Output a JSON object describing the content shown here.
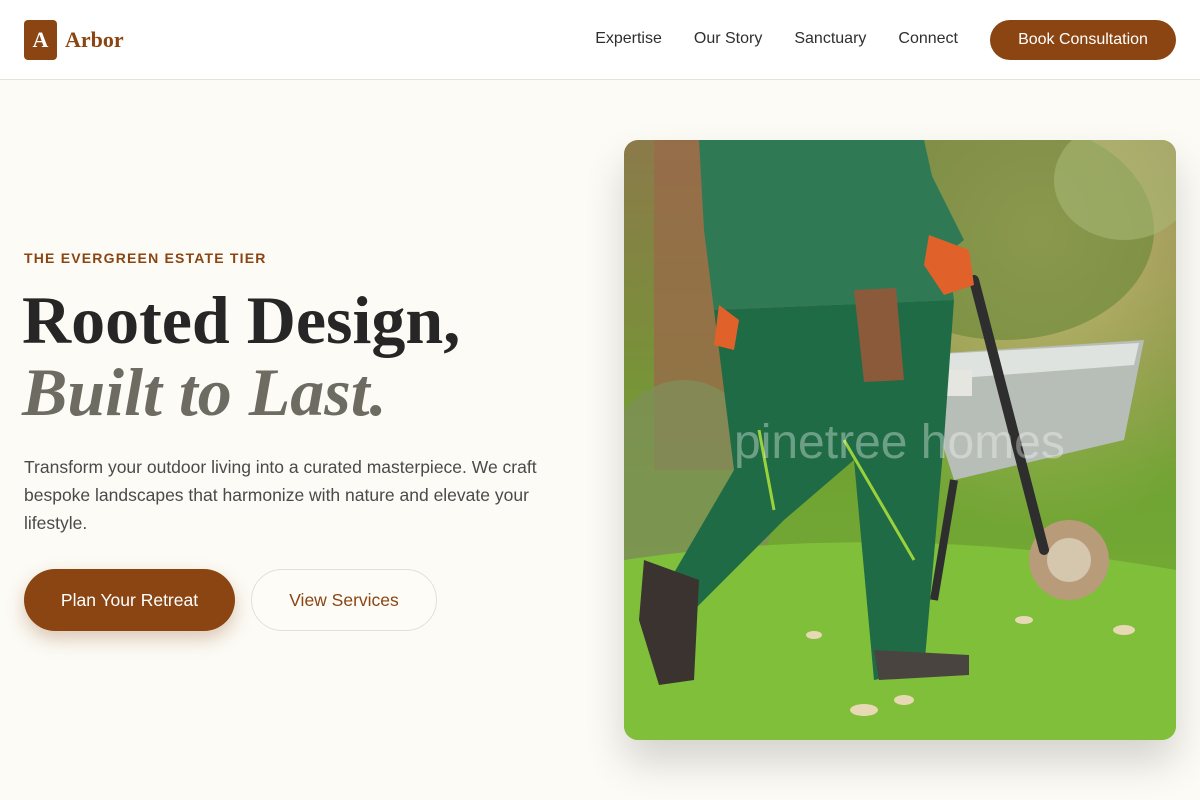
{
  "brand": {
    "mark": "A",
    "name": "Arbor"
  },
  "nav": {
    "items": [
      "Expertise",
      "Our Story",
      "Sanctuary",
      "Connect"
    ],
    "cta": "Book Consultation"
  },
  "hero": {
    "eyebrow": "THE EVERGREEN ESTATE TIER",
    "title_line1": "Rooted Design,",
    "title_line2": "Built to Last.",
    "lead": "Transform your outdoor living into a curated masterpiece. We craft bespoke landscapes that harmonize with nature and elevate your lifestyle.",
    "primary_cta": "Plan Your Retreat",
    "secondary_cta": "View Services",
    "image_watermark": "pinetree homes"
  },
  "colors": {
    "accent": "#8a4513",
    "background": "#fcfbf5"
  },
  "icons": {
    "logo": "letter-a-logo-mark"
  }
}
